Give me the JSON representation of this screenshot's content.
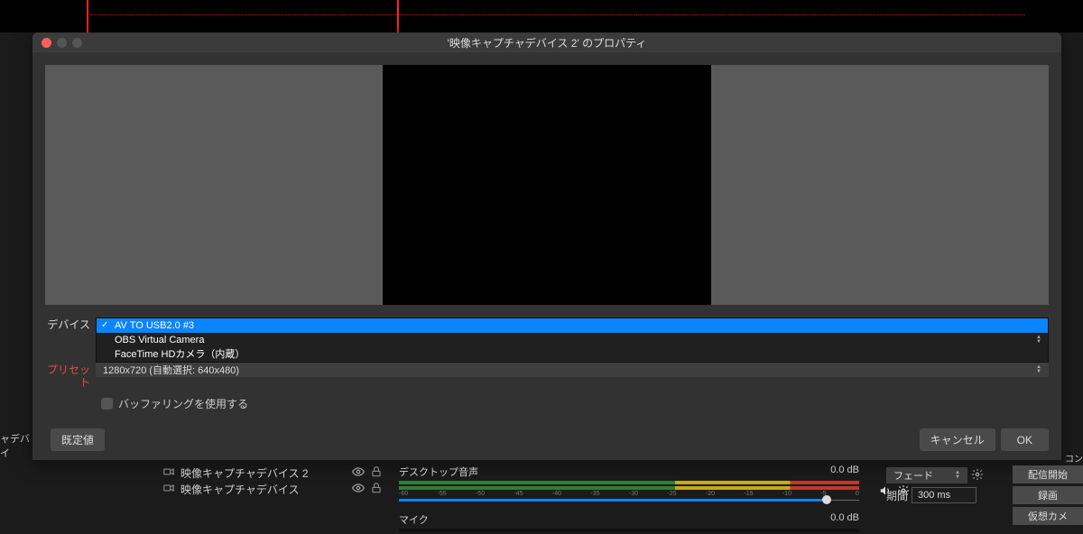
{
  "dialog": {
    "title": "'映像キャプチャデバイス 2' のプロパティ",
    "labels": {
      "device": "デバイス",
      "preset": "プリセット"
    },
    "device_options": [
      "AV TO USB2.0 #3",
      "OBS Virtual Camera",
      "FaceTime HDカメラ（内蔵）"
    ],
    "preset_value": "1280x720 (自動選択: 640x480)",
    "buffering_label": "バッファリングを使用する",
    "buttons": {
      "defaults": "既定値",
      "cancel": "キャンセル",
      "ok": "OK"
    }
  },
  "bg": {
    "left_truncated": "ャデバイ"
  },
  "sources": {
    "items": [
      "映像キャプチャデバイス 2",
      "映像キャプチャデバイス"
    ]
  },
  "mixer": {
    "desktop": {
      "label": "デスクトップ音声",
      "db": "0.0 dB"
    },
    "mic": {
      "label": "マイク",
      "db": "0.0 dB"
    },
    "ticks": [
      "-60",
      "-55",
      "-50",
      "-45",
      "-40",
      "-35",
      "-30",
      "-25",
      "-20",
      "-15",
      "-10",
      "-5",
      "0"
    ]
  },
  "transition": {
    "type_label": "フェード",
    "duration_label": "期間",
    "duration_value": "300 ms"
  },
  "control_buttons": {
    "start_stream": "配信開始",
    "start_record": "録画",
    "virtual_cam": "仮想カメ"
  },
  "right_edge": "コン"
}
